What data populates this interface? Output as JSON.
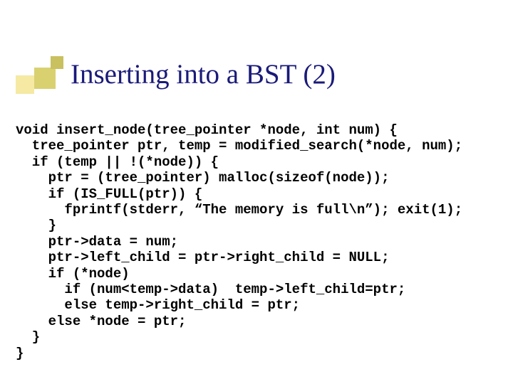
{
  "title": "Inserting into a BST (2)",
  "code": "void insert_node(tree_pointer *node, int num) {\n  tree_pointer ptr, temp = modified_search(*node, num);\n  if (temp || !(*node)) {\n    ptr = (tree_pointer) malloc(sizeof(node));\n    if (IS_FULL(ptr)) {\n      fprintf(stderr, “The memory is full\\n”); exit(1);\n    }\n    ptr->data = num;\n    ptr->left_child = ptr->right_child = NULL;\n    if (*node)\n      if (num<temp->data)  temp->left_child=ptr;\n      else temp->right_child = ptr;\n    else *node = ptr;\n  }\n}"
}
